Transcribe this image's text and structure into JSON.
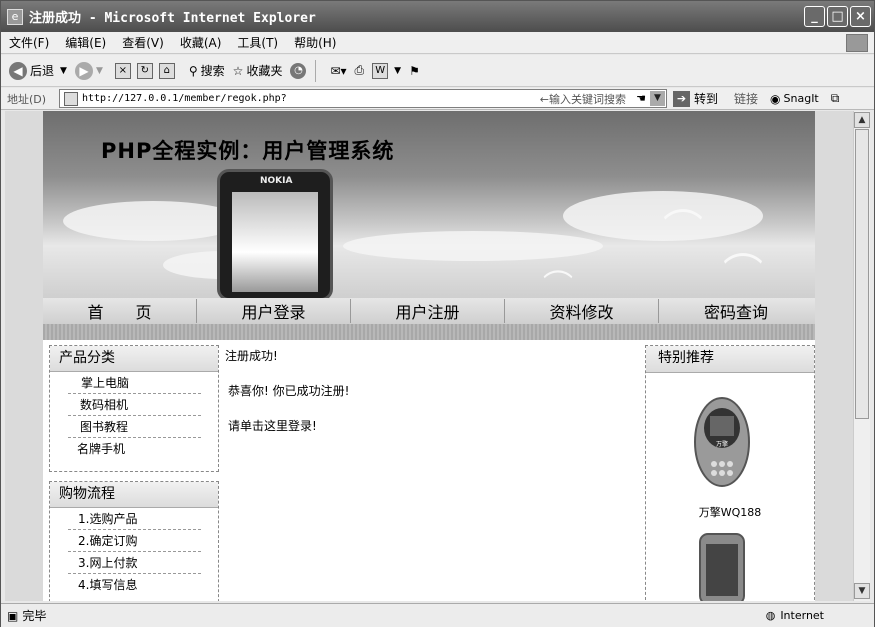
{
  "window": {
    "title": "注册成功 - Microsoft Internet Explorer",
    "controls": [
      "_",
      "□",
      "×"
    ]
  },
  "menu": [
    "文件(F)",
    "编辑(E)",
    "查看(V)",
    "收藏(A)",
    "工具(T)",
    "帮助(H)"
  ],
  "toolbar": {
    "back": "后退",
    "search": "搜索",
    "favorites": "收藏夹"
  },
  "address": {
    "label": "地址(D)",
    "url": "http://127.0.0.1/member/regok.php?",
    "hint": "←输入关键词搜索",
    "go": "转到",
    "links": "链接",
    "snagit": "SnagIt"
  },
  "site": {
    "title": "PHP全程实例：用户管理系统",
    "phone_brand": "NOKIA",
    "nav": [
      "首　　页",
      "用户登录",
      "用户注册",
      "资料修改",
      "密码查询"
    ]
  },
  "left": {
    "categories_title": "产品分类",
    "categories": [
      "掌上电脑",
      "数码相机",
      "图书教程",
      "名牌手机"
    ],
    "flow_title": "购物流程",
    "flow": [
      "1.选购产品",
      "2.确定订购",
      "3.网上付款",
      "4.填写信息"
    ]
  },
  "content": {
    "line1": "注册成功!",
    "line2": "恭喜你! 你已成功注册!",
    "line3_prefix": "请单击",
    "line3_link": "这里",
    "line3_suffix": "登录!"
  },
  "right": {
    "title": "特别推荐",
    "products": [
      {
        "name": "万擎WQ188",
        "brand": "万擎"
      }
    ]
  },
  "status": {
    "text": "完毕",
    "zone": "Internet"
  }
}
